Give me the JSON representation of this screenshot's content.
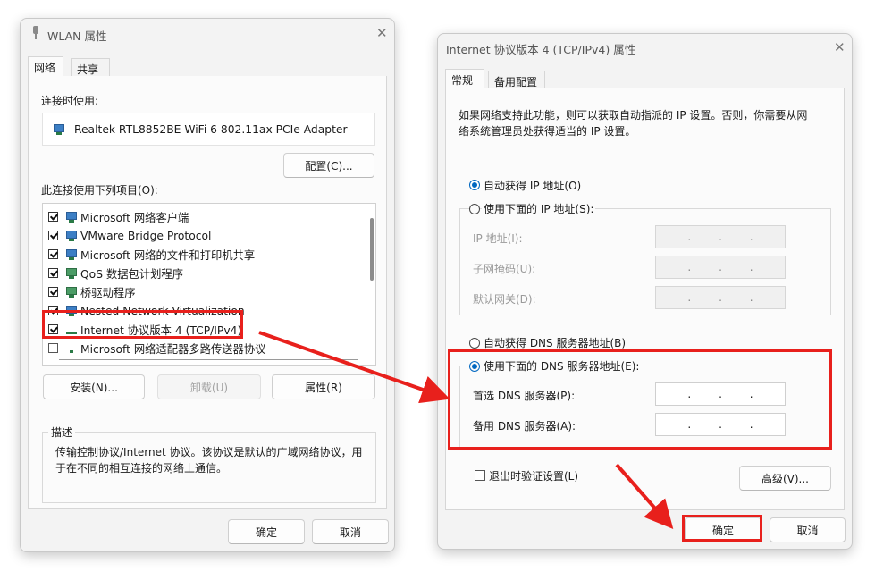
{
  "left_dialog": {
    "title": "WLAN 属性",
    "tabs": [
      "网络",
      "共享"
    ],
    "connect_using_label": "连接时使用:",
    "adapter_name": "Realtek RTL8852BE WiFi 6 802.11ax PCIe Adapter",
    "configure_button": "配置(C)...",
    "items_label": "此连接使用下列项目(O):",
    "items": [
      {
        "label": "Microsoft 网络客户端",
        "checked": true
      },
      {
        "label": "VMware Bridge Protocol",
        "checked": true
      },
      {
        "label": "Microsoft 网络的文件和打印机共享",
        "checked": true
      },
      {
        "label": "QoS 数据包计划程序",
        "checked": true
      },
      {
        "label": "桥驱动程序",
        "checked": true
      },
      {
        "label": "Nested Network Virtualization",
        "checked": true
      },
      {
        "label": "Internet 协议版本 4 (TCP/IPv4)",
        "checked": true
      },
      {
        "label": "Microsoft 网络适配器多路传送器协议",
        "checked": false
      }
    ],
    "install_button": "安装(N)...",
    "uninstall_button": "卸载(U)",
    "properties_button": "属性(R)",
    "description_legend": "描述",
    "description_text_line1": "传输控制协议/Internet 协议。该协议是默认的广域网络协议，用",
    "description_text_line2": "于在不同的相互连接的网络上通信。",
    "ok_button": "确定",
    "cancel_button": "取消"
  },
  "right_dialog": {
    "title": "Internet 协议版本 4 (TCP/IPv4) 属性",
    "tabs": [
      "常规",
      "备用配置"
    ],
    "intro_line1": "如果网络支持此功能，则可以获取自动指派的 IP 设置。否则，你需要从网",
    "intro_line2": "络系统管理员处获得适当的 IP 设置。",
    "auto_ip_label": "自动获得 IP 地址(O)",
    "manual_ip_label": "使用下面的 IP 地址(S):",
    "ip_address_label": "IP 地址(I):",
    "subnet_mask_label": "子网掩码(U):",
    "gateway_label": "默认网关(D):",
    "auto_dns_label": "自动获得 DNS 服务器地址(B)",
    "manual_dns_label": "使用下面的 DNS 服务器地址(E):",
    "preferred_dns_label": "首选 DNS 服务器(P):",
    "alternate_dns_label": "备用 DNS 服务器(A):",
    "ip_dots": ".",
    "validate_on_exit_label": "退出时验证设置(L)",
    "advanced_button": "高级(V)...",
    "ok_button": "确定",
    "cancel_button": "取消",
    "selected_ip_mode": "auto",
    "selected_dns_mode": "manual",
    "validate_on_exit_checked": false
  },
  "colors": {
    "highlight_red": "#e8201c",
    "radio_blue": "#0067c0"
  }
}
